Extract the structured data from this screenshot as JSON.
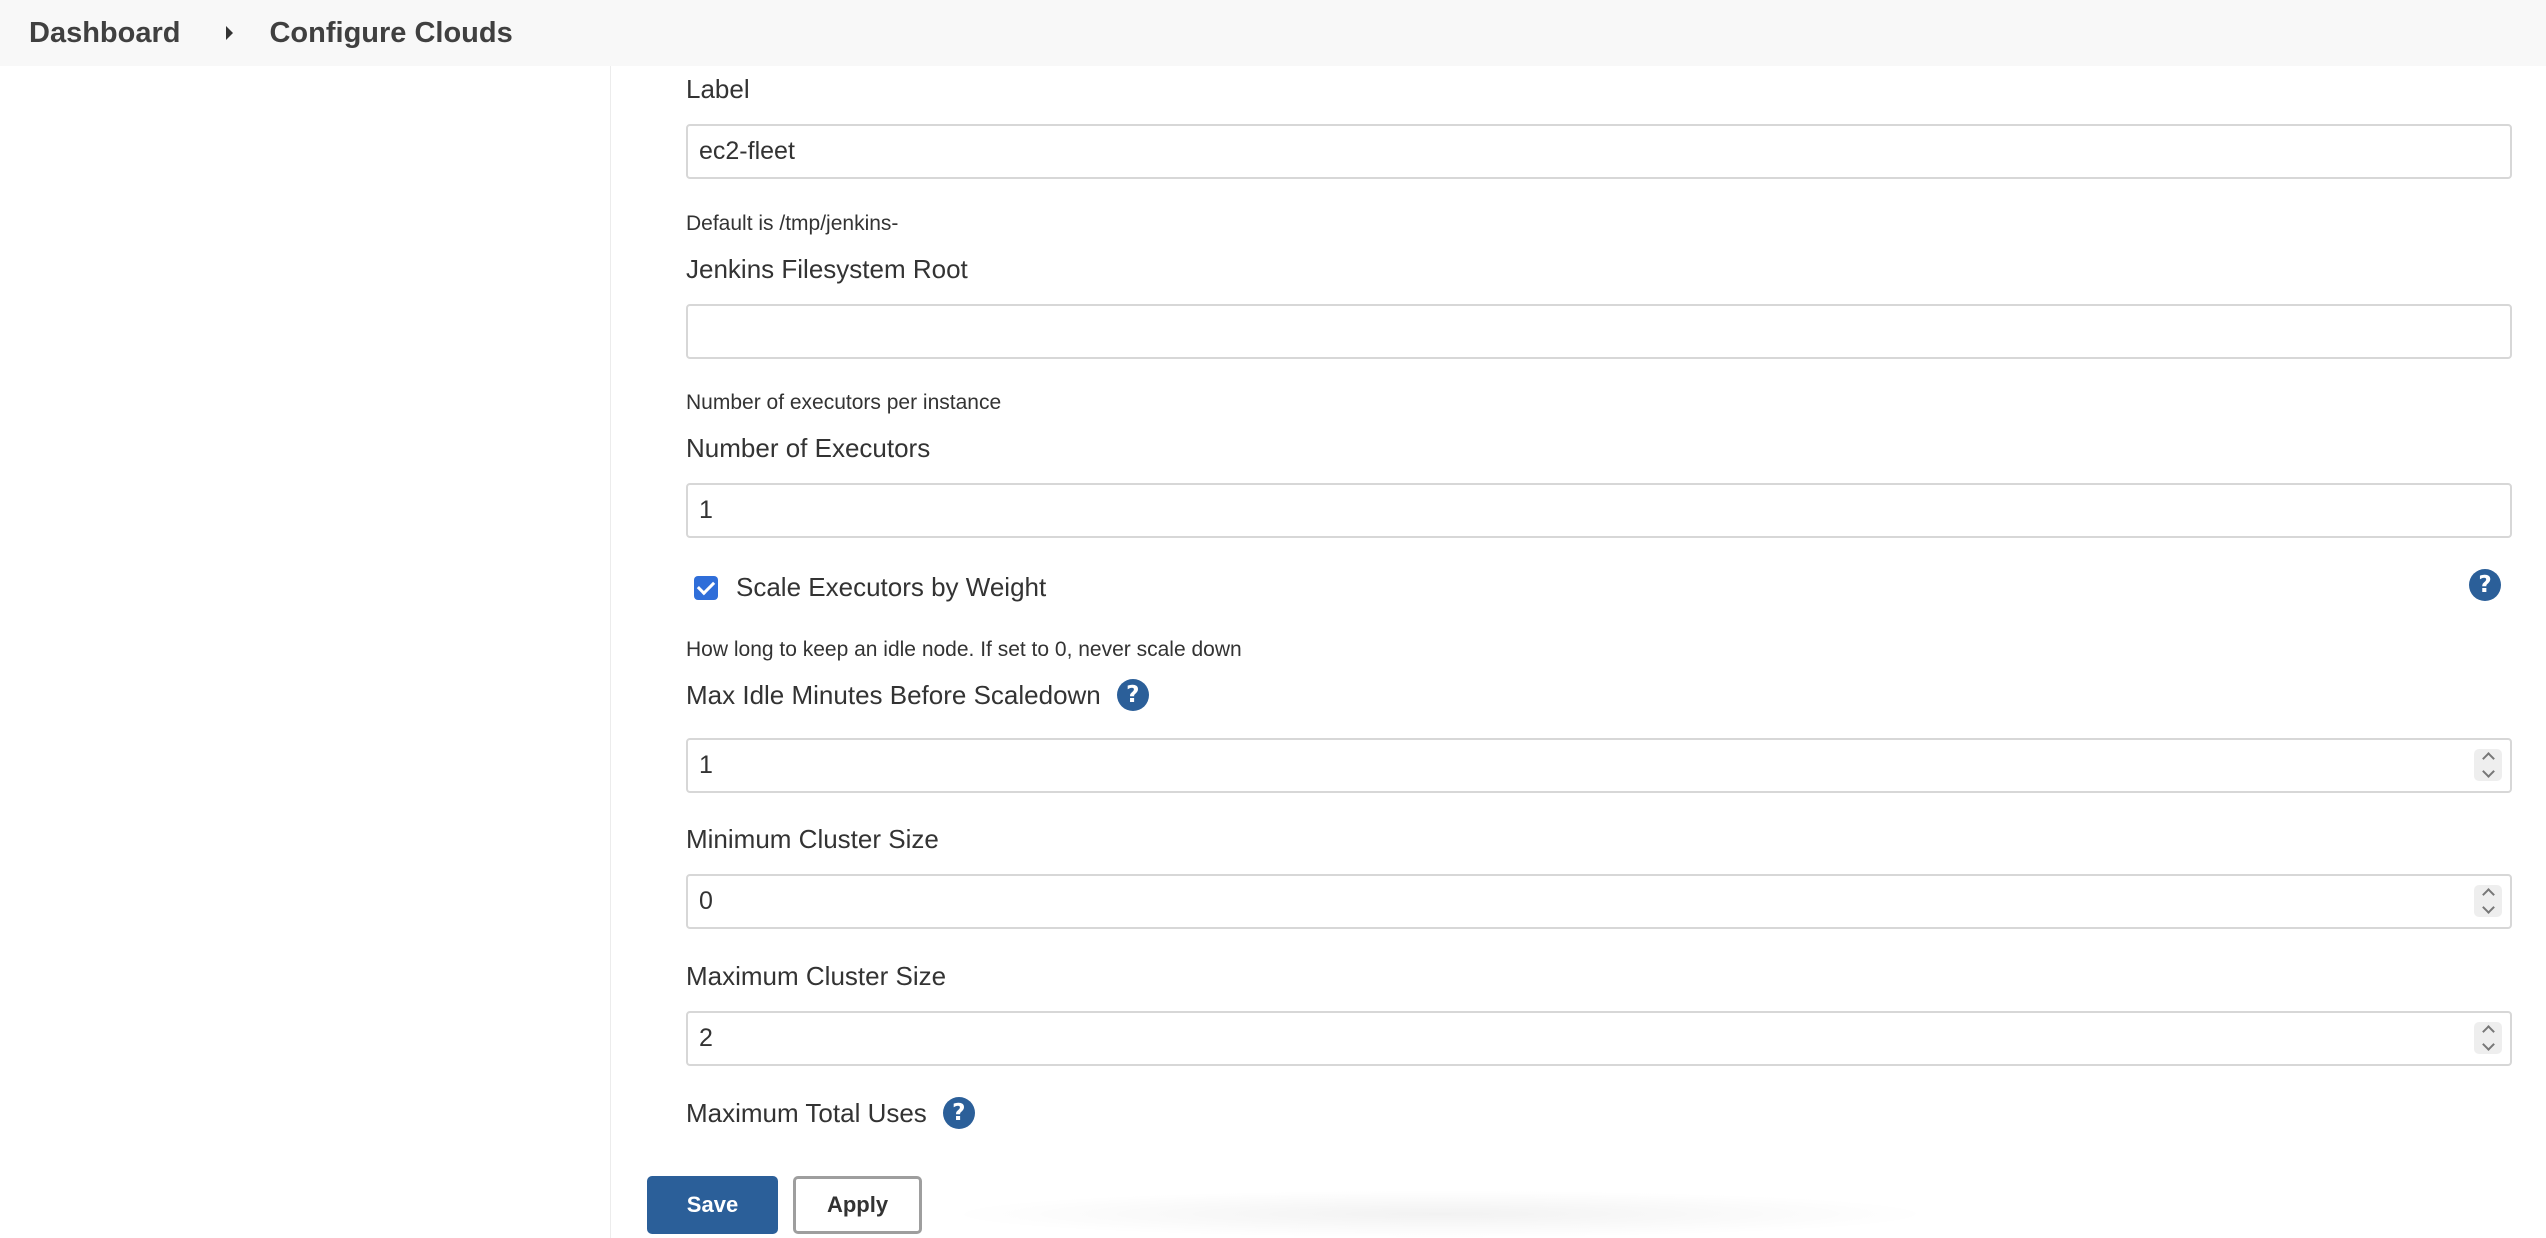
{
  "breadcrumb": {
    "items": [
      "Dashboard",
      "Configure Clouds"
    ]
  },
  "form": {
    "label": {
      "title": "Label",
      "value": "ec2-fleet"
    },
    "fs_root": {
      "description": "Default is /tmp/jenkins-",
      "title": "Jenkins Filesystem Root",
      "value": ""
    },
    "executors": {
      "description": "Number of executors per instance",
      "title": "Number of Executors",
      "value": "1"
    },
    "scale_by_weight": {
      "label": "Scale Executors by Weight",
      "checked": true
    },
    "max_idle": {
      "description": "How long to keep an idle node. If set to 0, never scale down",
      "title": "Max Idle Minutes Before Scaledown",
      "value": "1"
    },
    "min_cluster": {
      "title": "Minimum Cluster Size",
      "value": "0"
    },
    "max_cluster": {
      "title": "Maximum Cluster Size",
      "value": "2"
    },
    "max_total_uses": {
      "title": "Maximum Total Uses"
    }
  },
  "help_icon_glyph": "?",
  "buttons": {
    "save": "Save",
    "apply": "Apply"
  },
  "colors": {
    "accent": "#2b5f99",
    "checkbox": "#2f6ed9"
  },
  "icons": {
    "breadcrumb_separator": "caret-right-icon",
    "help": "question-circle-icon",
    "checkbox": "checkmark-icon"
  }
}
